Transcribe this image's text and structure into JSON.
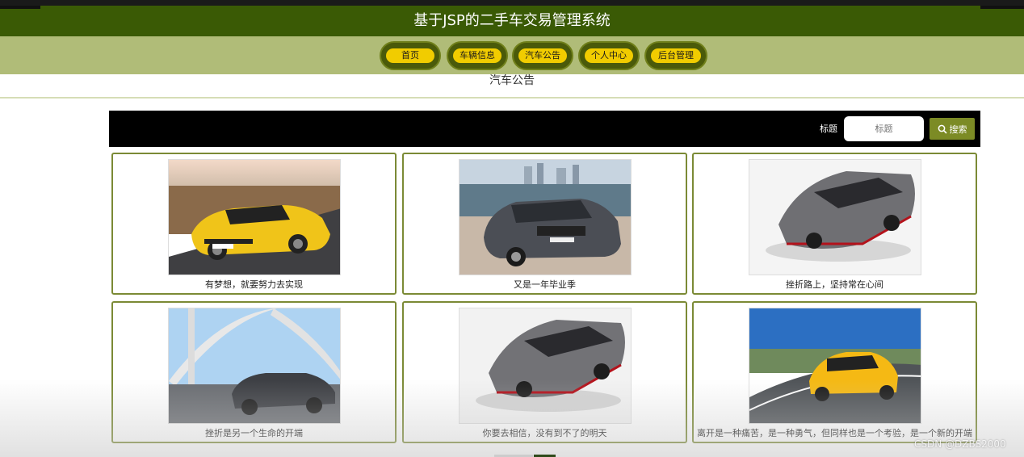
{
  "header": {
    "title": "基于JSP的二手车交易管理系统"
  },
  "nav": {
    "items": [
      {
        "label": "首页"
      },
      {
        "label": "车辆信息"
      },
      {
        "label": "汽车公告"
      },
      {
        "label": "个人中心"
      },
      {
        "label": "后台管理"
      }
    ]
  },
  "page": {
    "heading": "汽车公告"
  },
  "search": {
    "label": "标题",
    "placeholder": "标题",
    "button_label": "搜索"
  },
  "cards": [
    {
      "caption": "有梦想，就要努力去实现",
      "image": "yellow-sports-car-photo"
    },
    {
      "caption": "又是一年毕业季",
      "image": "gray-sedan-waterfront-photo"
    },
    {
      "caption": "挫折路上，坚持常在心间",
      "image": "silver-supercar-photo"
    },
    {
      "caption": "挫折是另一个生命的开端",
      "image": "sedan-on-bridge-photo"
    },
    {
      "caption": "你要去相信，没有到不了的明天",
      "image": "silver-supercar-photo"
    },
    {
      "caption": "离开是一种痛苦，是一种勇气，但同样也是一个考验，是一个新的开端",
      "image": "yellow-coupe-road-photo"
    }
  ],
  "watermark": "CSDN @DZBS2000",
  "colors": {
    "header_bg": "#3a5a05",
    "nav_bg": "#b0bc78",
    "nav_pill": "#f1cc00",
    "search_button": "#7c8b25",
    "card_border": "#7b8a35"
  }
}
